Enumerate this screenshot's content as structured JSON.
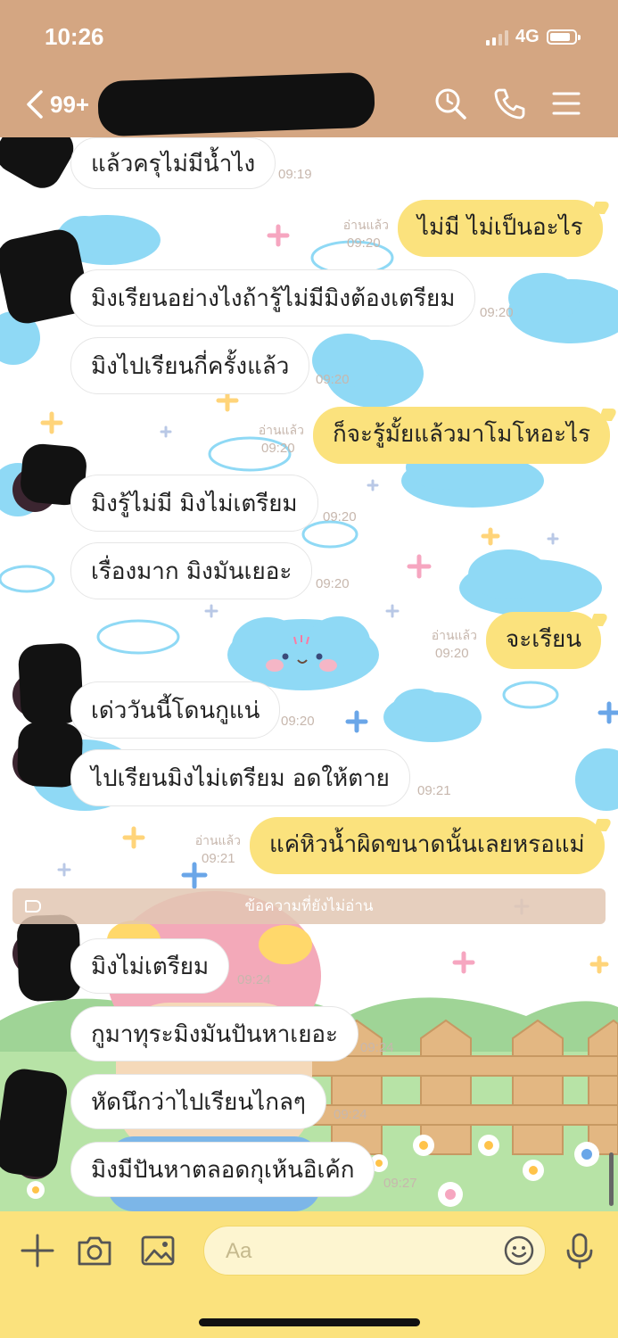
{
  "status_bar": {
    "time": "10:26",
    "network": "4G",
    "battery_level": 0.85
  },
  "header": {
    "back_count": "99+"
  },
  "messages": [
    {
      "side": "in",
      "text": "แล้วครุไม่มีน้ำไง",
      "time": "09:19"
    },
    {
      "side": "out",
      "text": "ไม่มี ไม่เป็นอะไร",
      "time": "09:20",
      "read": "อ่านแล้ว"
    },
    {
      "side": "in",
      "text": "มิงเรียนอย่างไงถ้ารู้ไม่มีมิงต้องเตรียม",
      "time": "09:20"
    },
    {
      "side": "in",
      "text": "มิงไปเรียนกี่ครั้งแล้ว",
      "time": "09:20"
    },
    {
      "side": "out",
      "text": "ก็จะรู้มั้ยแล้วมาโมโหอะไร",
      "time": "09:20",
      "read": "อ่านแล้ว"
    },
    {
      "side": "in",
      "text": "มิงรู้ไม่มี มิงไม่เตรียม",
      "time": "09:20"
    },
    {
      "side": "in",
      "text": "เรื่องมาก มิงมันเยอะ",
      "time": "09:20"
    },
    {
      "side": "out",
      "text": "จะเรียน",
      "time": "09:20",
      "read": "อ่านแล้ว"
    },
    {
      "side": "in",
      "text": "เด่ววันนี้โดนกูแน่",
      "time": "09:20"
    },
    {
      "side": "in",
      "text": "ไปเรียนมิงไม่เตรียม อดให้ตาย",
      "time": "09:21"
    },
    {
      "side": "out",
      "text": "แค่หิวน้ำผิดขนาดนั้นเลยหรอแม่",
      "time": "09:21",
      "read": "อ่านแล้ว"
    },
    {
      "side": "in",
      "text": "มิงไม่เตรียม",
      "time": "09:24"
    },
    {
      "side": "in",
      "text": "กูมาทุระมิงมันปันหาเยอะ",
      "time": "09:24"
    },
    {
      "side": "in",
      "text": "หัดนึกว่าไปเรียนไกลๆ",
      "time": "09:24"
    },
    {
      "side": "in",
      "text": "มิงมีปันหาตลอดกุเห้นอิเค้ก",
      "time": "09:27"
    }
  ],
  "divider": {
    "label": "ข้อความที่ยังไม่อ่าน"
  },
  "input": {
    "placeholder": "Aa"
  },
  "icons": {
    "back": "chevron-left-icon",
    "search": "search-icon",
    "call": "phone-icon",
    "menu": "menu-icon",
    "add": "plus-icon",
    "camera": "camera-icon",
    "image": "image-icon",
    "emoji": "emoji-icon",
    "mic": "mic-icon"
  },
  "colors": {
    "header": "#d4a682",
    "outgoing_bubble": "#fbe27d",
    "input_bar": "#fbe27d"
  }
}
